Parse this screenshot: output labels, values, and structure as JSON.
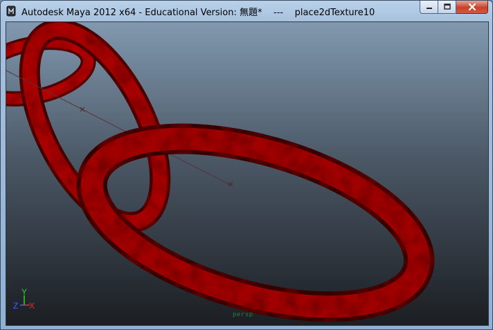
{
  "window": {
    "title": "Autodesk Maya 2012 x64 - Educational Version: 無題*    ---    place2dTexture10",
    "controls": [
      "minimize-icon",
      "maximize-icon",
      "close-icon"
    ]
  },
  "viewport": {
    "camera_label": "persp",
    "axis": {
      "y": "Y",
      "z": "Z",
      "x": "X"
    },
    "colors": {
      "bg_top": "#7f97ad",
      "bg_bottom": "#1c1f23",
      "torus": "#a00000",
      "torus_dark": "#3a0000"
    }
  }
}
